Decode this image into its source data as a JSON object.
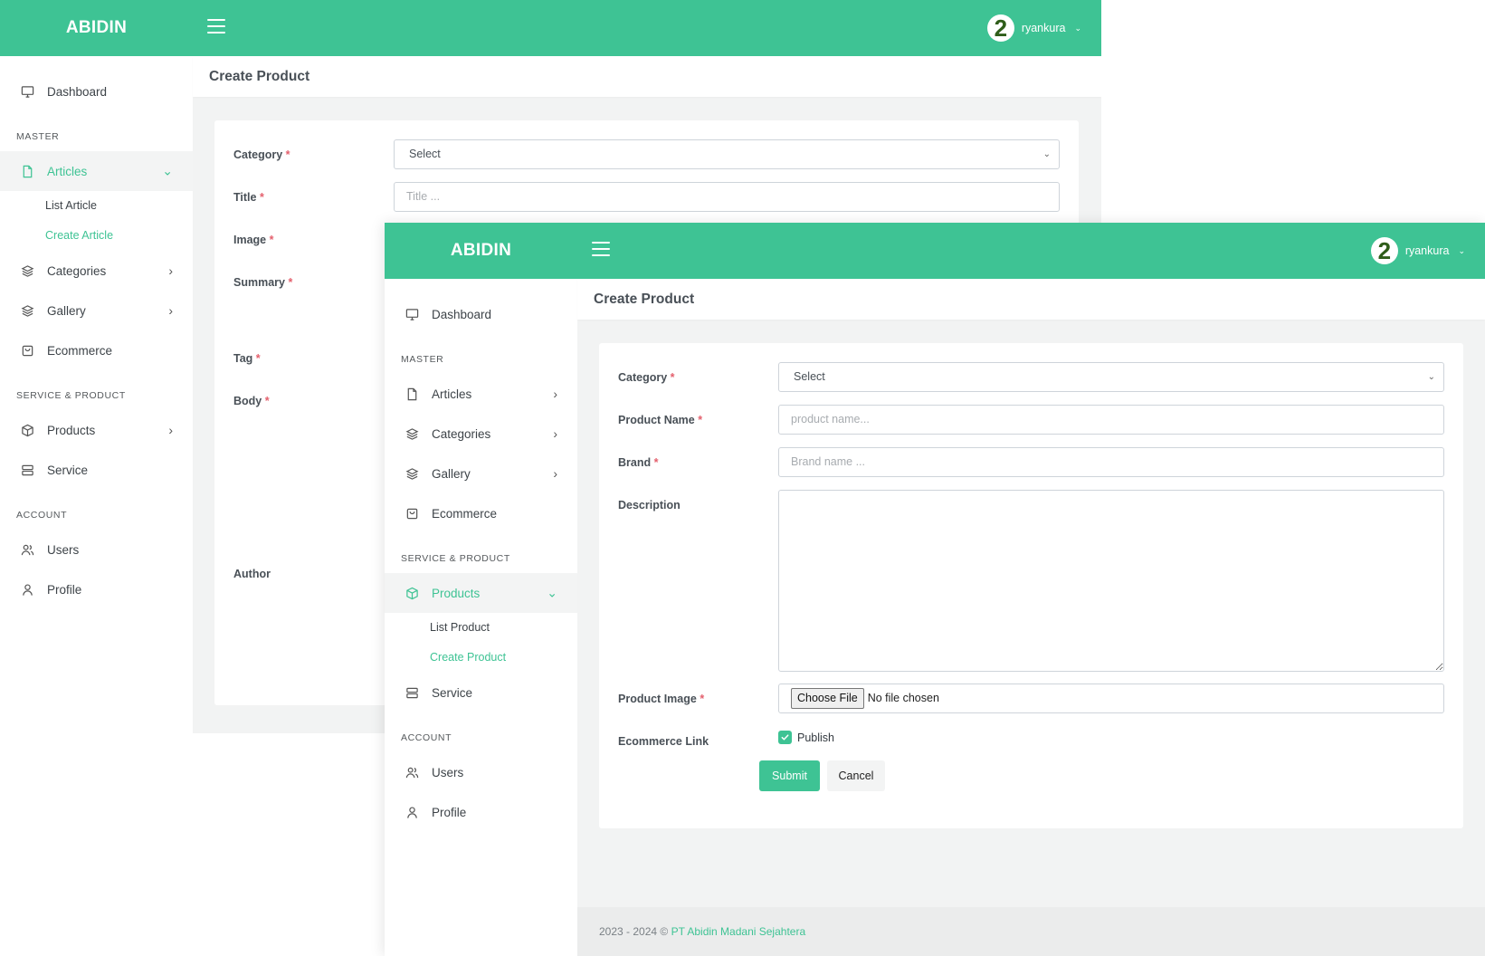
{
  "brand": "ABIDIN",
  "user": {
    "name": "ryankura",
    "avatar_glyph": "2"
  },
  "sidebar_common": {
    "dashboard": "Dashboard",
    "master_label": "MASTER",
    "articles": "Articles",
    "list_article": "List Article",
    "create_article": "Create Article",
    "categories": "Categories",
    "gallery": "Gallery",
    "ecommerce": "Ecommerce",
    "service_product_label": "SERVICE & PRODUCT",
    "products": "Products",
    "list_product": "List Product",
    "create_product": "Create Product",
    "service": "Service",
    "account_label": "ACCOUNT",
    "users": "Users",
    "profile": "Profile"
  },
  "back_window": {
    "page_title": "Create Product",
    "form": {
      "category_label": "Category",
      "category_value": "Select",
      "title_label": "Title",
      "title_placeholder": "Title ...",
      "image_label": "Image",
      "summary_label": "Summary",
      "tag_label": "Tag",
      "body_label": "Body",
      "author_label": "Author"
    }
  },
  "front_window": {
    "page_title": "Create Product",
    "form": {
      "category_label": "Category",
      "category_value": "Select",
      "product_name_label": "Product Name",
      "product_name_placeholder": "product name...",
      "brand_label": "Brand",
      "brand_placeholder": "Brand name ...",
      "description_label": "Description",
      "product_image_label": "Product Image",
      "choose_file": "Choose File",
      "no_file": "No file chosen",
      "ecommerce_link_label": "Ecommerce Link",
      "publish_label": "Publish",
      "publish_checked": true,
      "submit": "Submit",
      "cancel": "Cancel"
    },
    "footer": {
      "years": "2023 - 2024 ©",
      "company": "PT Abidin Madani Sejahtera"
    }
  },
  "required_mark": "*",
  "colors": {
    "accent": "#3ec394",
    "required": "#e4606d",
    "background": "#f2f3f3"
  },
  "icons": [
    "monitor-icon",
    "file-icon",
    "layers-icon",
    "shopping-bag-icon",
    "box-icon",
    "server-icon",
    "users-icon",
    "user-icon",
    "menu-icon",
    "chevron-down-icon",
    "chevron-right-icon",
    "check-icon"
  ]
}
